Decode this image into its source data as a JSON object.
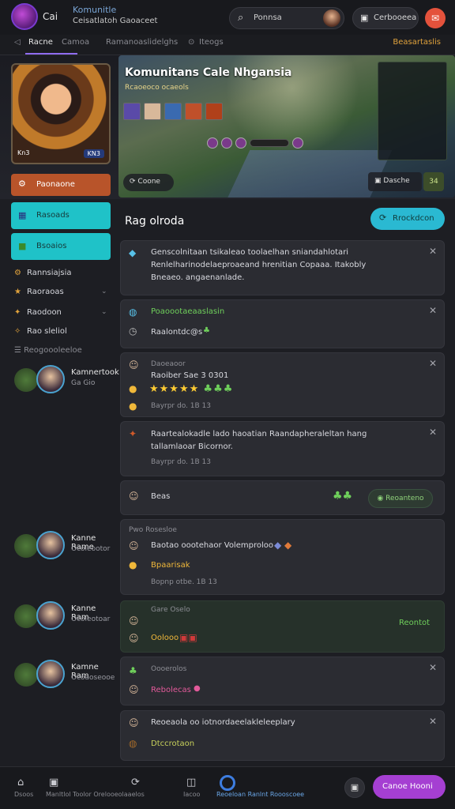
{
  "header": {
    "app_name": "Cai",
    "community_title": "Komunitle",
    "community_sub": "Ceisatlatoh Gaoaceet",
    "search_placeholder": "Ponnsa",
    "connect_label": "Cerbooeea",
    "notif_glyph": "✉"
  },
  "tabs": {
    "items": [
      "Racne",
      "Camoa",
      "Ramanoaslidelghs",
      "Iteogs"
    ],
    "right": "Beasartaslis"
  },
  "hero": {
    "title": "Komunitans Cale Nhgansia",
    "subtitle": "Rcaoeoco ocaeols",
    "portrait_badge": "KN3",
    "portrait_label": "Kn3",
    "play_label": "Coone",
    "stat_label": "Dasche",
    "count_label": "34"
  },
  "sidebar": {
    "primary_label": "Paonaone",
    "btn1": "Rasoads",
    "btn2": "Bsoaios",
    "items": [
      {
        "label": "Rannsiajsia",
        "icon": "⚙"
      },
      {
        "label": "Raoraoas",
        "icon": "★"
      },
      {
        "label": "Raodoon",
        "icon": "✦"
      },
      {
        "label": "Rao sleliol",
        "icon": "✧"
      }
    ],
    "section_label": "Reogoooleeloe",
    "players": [
      {
        "name": "Kamnertook",
        "sub": "Ga Gio"
      },
      {
        "name": "Kanne Rame",
        "sub": "Ocoleootor"
      },
      {
        "name": "Kanne Ram",
        "sub": "Ocoleotoar"
      },
      {
        "name": "Kamne Ram",
        "sub": "Ocoaoseooe"
      }
    ]
  },
  "main": {
    "title": "Rag olroda",
    "follow_label": "Rrockdcon",
    "cards": [
      {
        "line1": "Genscolnitaan tsikaleao toolaelhan sniandahlotari",
        "line2": "Renlelharinodelaeproaeand hrenitian Copaaa. Itakobly",
        "line3": "Bneaeo. angaenanlade."
      },
      {
        "title": "Poaoootaeaaslasin",
        "line": "Raalontdc@s"
      },
      {
        "title": "Daoeaoor",
        "line": "Raoiber Sae 3 0301",
        "time": "Bayrpr do. 1B 13"
      },
      {
        "line1": "Raartealokadle lado haoatian Raandapheraleltan hang",
        "line2": "tallamlaoar Bicornor.",
        "time": "Bayrpr do. 1B 13"
      },
      {
        "line": "Beas",
        "btn": "Reoanteno"
      },
      {
        "title": "Pwo Rosesloe",
        "line": "Baotao oootehaor Volemproloo",
        "sub": "Bpaarisak",
        "time": "Bopnp otbe. 1B 13"
      },
      {
        "title": "Gare Oselo",
        "line": "Oolooo",
        "status": "Reontot"
      },
      {
        "title": "Oooerolos",
        "line": "Rebolecas"
      },
      {
        "line": "Reoeaola oo iotnordaeelakleleeplary",
        "sub": "Dtccrotaon"
      }
    ]
  },
  "bottom_nav": [
    {
      "label": "Dsoos",
      "icon": "⌂"
    },
    {
      "label": "Manltlol Toolor Orelooeolaaelos",
      "icon": "▣"
    },
    {
      "label": "Iacoo",
      "icon": "◫"
    },
    {
      "label": "Reoeloan Ranlnt Roooscoee",
      "icon": "●"
    }
  ],
  "cta_label": "Canoe Hooni",
  "colors": {
    "accent": "#8f6cf0",
    "teal": "#1fc2c8",
    "orange": "#b8542a",
    "cta": "#a53fd2"
  }
}
